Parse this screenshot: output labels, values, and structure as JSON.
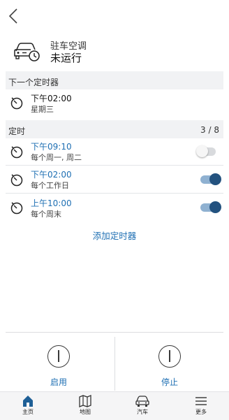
{
  "status": {
    "title": "驻车空调",
    "value": "未运行"
  },
  "next_timer": {
    "section_label": "下一个定时器",
    "time": "下午02:00",
    "day": "星期三"
  },
  "timers": {
    "section_label": "定时",
    "count": "3 / 8",
    "items": [
      {
        "time": "下午09:10",
        "days": "每个周一, 周二",
        "enabled": false
      },
      {
        "time": "下午02:00",
        "days": "每个工作日",
        "enabled": true
      },
      {
        "time": "上午10:00",
        "days": "每个周末",
        "enabled": true
      }
    ],
    "add_label": "添加定时器"
  },
  "actions": {
    "start_label": "启用",
    "stop_label": "停止"
  },
  "tabs": [
    {
      "label": "主页",
      "icon": "home-icon",
      "active": true
    },
    {
      "label": "地图",
      "icon": "map-icon",
      "active": false
    },
    {
      "label": "汽车",
      "icon": "car-icon",
      "active": false
    },
    {
      "label": "更多",
      "icon": "menu-icon",
      "active": false
    }
  ],
  "colors": {
    "accent": "#1e6fb3",
    "toggle_on": "#23527f",
    "band": "#f1f2f4"
  }
}
